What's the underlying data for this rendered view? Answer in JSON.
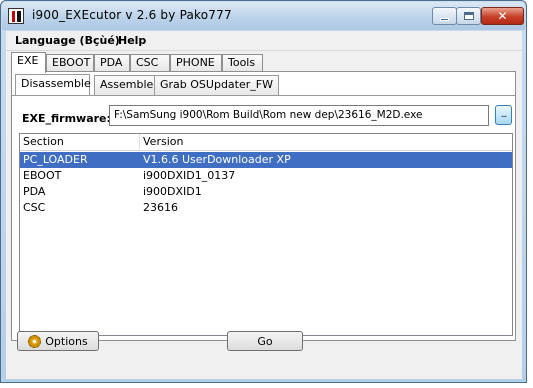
{
  "window": {
    "title": "i900_EXEcutor  v 2.6  by  Pako777"
  },
  "menu": [
    {
      "label": "Language (Bçùé)"
    },
    {
      "label": "Help"
    }
  ],
  "tabs": [
    {
      "label": "EXE"
    },
    {
      "label": "EBOOT"
    },
    {
      "label": "PDA"
    },
    {
      "label": "CSC"
    },
    {
      "label": "PHONE"
    },
    {
      "label": "Tools"
    }
  ],
  "subtabs": [
    {
      "label": "Disassemble"
    },
    {
      "label": "Assemble"
    },
    {
      "label": "Grab OSUpdater_FW"
    }
  ],
  "firmware": {
    "label": "EXE_firmware:",
    "value": "F:\\SamSung i900\\Rom Build\\Rom new dep\\23616_M2D.exe",
    "browse_label": "..."
  },
  "table": {
    "columns": [
      "Section",
      "Version"
    ],
    "rows": [
      {
        "section": "PC_LOADER",
        "version": "V1.6.6 UserDownloader XP"
      },
      {
        "section": "EBOOT",
        "version": "i900DXID1_0137"
      },
      {
        "section": "PDA",
        "version": "i900DXID1"
      },
      {
        "section": "CSC",
        "version": "23616"
      }
    ],
    "selected_row": "PC_LOADER"
  },
  "buttons": {
    "options": "Options",
    "go": "Go"
  },
  "colors": {
    "selection": "#3f6ec2",
    "close_button": "#c5402a"
  }
}
